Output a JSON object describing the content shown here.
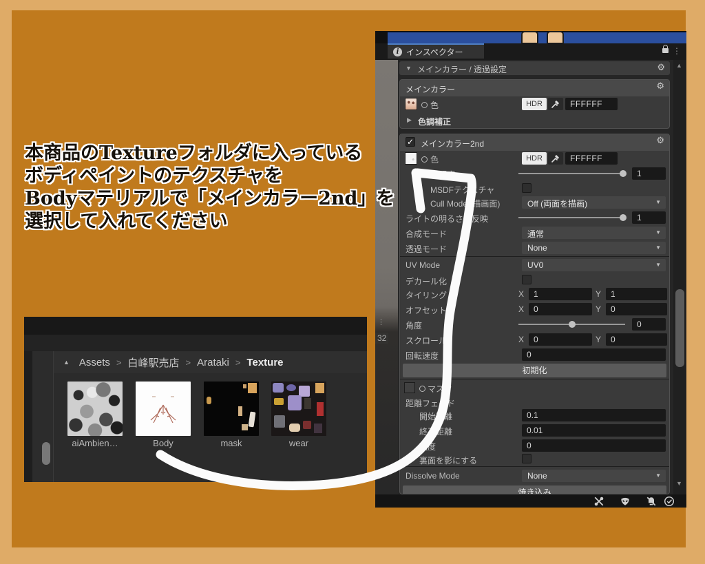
{
  "colors": {
    "frame_outer": "#dfab67",
    "frame_inner": "#c07a1d",
    "selection_blue": "#2b4f9e",
    "panel_dark": "#262626",
    "arrow_white": "#fbfbfb"
  },
  "instruction": {
    "lines": [
      "本商品のTextureフォルダに入っている",
      "ボディペイントのテクスチャを",
      "Bodyマテリアルで「メインカラー2nd」を",
      "選択して入れてください"
    ]
  },
  "icons": {
    "collapse_down": "▼",
    "expand_right": "▶",
    "collapse_up": "▲",
    "dropdown_arrow": "▼",
    "scroll_up": "▲",
    "scroll_down": "▼",
    "dots_vertical": "⋮",
    "gear": "⚙",
    "check": "✓",
    "info": "i",
    "chevron": ">"
  },
  "project": {
    "count_label": "32",
    "breadcrumb": {
      "sep": ">",
      "s0": "Assets",
      "s1": "白峰駅売店",
      "s2": "Arataki",
      "s3": "Texture"
    },
    "items": [
      {
        "label": "aiAmbien…"
      },
      {
        "label": "Body"
      },
      {
        "label": "mask"
      },
      {
        "label": "wear"
      }
    ]
  },
  "inspector": {
    "tab_label": "インスペクター",
    "header": "メインカラー / 透過設定",
    "main_color": {
      "title": "メインカラー",
      "color_label": "色",
      "hdr_label": "HDR",
      "hex_value": "FFFFFF",
      "tone_label": "色調補正"
    },
    "second": {
      "title": "メインカラー2nd",
      "color_label": "色",
      "hdr_label": "HDR",
      "hex_value": "FFFFFF",
      "opacity_label": "透明度",
      "opacity_value": "1",
      "msdf_label": "MSDFテクスチャ",
      "cull_label": "Cull Mode (描画面)",
      "cull_value": "Off (両面を描画)",
      "light_label": "ライトの明るさを反映",
      "light_value": "1",
      "blend_label": "合成モード",
      "blend_value": "通常",
      "trans_label": "透過モード",
      "trans_value": "None",
      "uv_label": "UV Mode",
      "uv_value": "UV0",
      "decal_label": "デカール化",
      "tiling_label": "タイリング",
      "axis_x": "X",
      "axis_y": "Y",
      "tiling_x": "1",
      "tiling_y": "1",
      "offset_label": "オフセット",
      "offset_x": "0",
      "offset_y": "0",
      "angle_label": "角度",
      "angle_value": "0",
      "scroll_label": "スクロール",
      "scroll_x": "0",
      "scroll_y": "0",
      "rotspeed_label": "回転速度",
      "rotspeed_value": "0",
      "init_label": "初期化",
      "mask_label": "マスク",
      "fade_label": "距離フェード",
      "fade_start_label": "開始距離",
      "fade_start_value": "0.1",
      "fade_end_label": "終了距離",
      "fade_end_value": "0.01",
      "strength_label": "強度",
      "strength_value": "0",
      "backshadow_label": "裏面を影にする",
      "dissolve_label": "Dissolve Mode",
      "dissolve_value": "None",
      "bake_label": "焼き込み"
    }
  }
}
